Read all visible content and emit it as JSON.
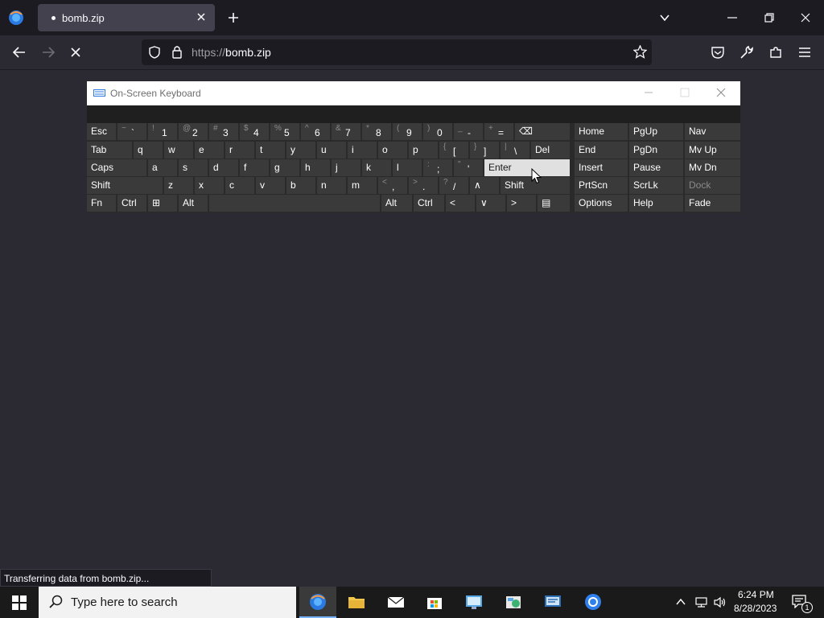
{
  "browser": {
    "tab_title": "bomb.zip",
    "url_scheme": "https://",
    "url_host": "bomb.zip",
    "status_text": "Transferring data from bomb.zip..."
  },
  "osk": {
    "title": "On-Screen Keyboard",
    "rows": [
      [
        {
          "main": "Esc"
        },
        {
          "main": "`",
          "shift": "~"
        },
        {
          "main": "1",
          "shift": "!"
        },
        {
          "main": "2",
          "shift": "@"
        },
        {
          "main": "3",
          "shift": "#"
        },
        {
          "main": "4",
          "shift": "$"
        },
        {
          "main": "5",
          "shift": "%"
        },
        {
          "main": "6",
          "shift": "^"
        },
        {
          "main": "7",
          "shift": "&"
        },
        {
          "main": "8",
          "shift": "*"
        },
        {
          "main": "9",
          "shift": "("
        },
        {
          "main": "0",
          "shift": ")"
        },
        {
          "main": "-",
          "shift": "_"
        },
        {
          "main": "=",
          "shift": "+"
        },
        {
          "main": "⌫"
        }
      ],
      [
        {
          "main": "Tab"
        },
        {
          "main": "q"
        },
        {
          "main": "w"
        },
        {
          "main": "e"
        },
        {
          "main": "r"
        },
        {
          "main": "t"
        },
        {
          "main": "y"
        },
        {
          "main": "u"
        },
        {
          "main": "i"
        },
        {
          "main": "o"
        },
        {
          "main": "p"
        },
        {
          "main": "[",
          "shift": "{"
        },
        {
          "main": "]",
          "shift": "}"
        },
        {
          "main": "\\",
          "shift": "|"
        },
        {
          "main": "Del"
        }
      ],
      [
        {
          "main": "Caps"
        },
        {
          "main": "a"
        },
        {
          "main": "s"
        },
        {
          "main": "d"
        },
        {
          "main": "f"
        },
        {
          "main": "g"
        },
        {
          "main": "h"
        },
        {
          "main": "j"
        },
        {
          "main": "k"
        },
        {
          "main": "l"
        },
        {
          "main": ";",
          "shift": ":"
        },
        {
          "main": "'",
          "shift": "\""
        },
        {
          "main": "Enter"
        }
      ],
      [
        {
          "main": "Shift"
        },
        {
          "main": "z"
        },
        {
          "main": "x"
        },
        {
          "main": "c"
        },
        {
          "main": "v"
        },
        {
          "main": "b"
        },
        {
          "main": "n"
        },
        {
          "main": "m"
        },
        {
          "main": ",",
          "shift": "<"
        },
        {
          "main": ".",
          "shift": ">"
        },
        {
          "main": "/",
          "shift": "?"
        },
        {
          "main": "∧"
        },
        {
          "main": "Shift"
        }
      ],
      [
        {
          "main": "Fn"
        },
        {
          "main": "Ctrl"
        },
        {
          "main": "⊞"
        },
        {
          "main": "Alt"
        },
        {
          "main": ""
        },
        {
          "main": "Alt"
        },
        {
          "main": "Ctrl"
        },
        {
          "main": "<"
        },
        {
          "main": "∨"
        },
        {
          "main": ">"
        },
        {
          "main": "▤"
        }
      ]
    ],
    "nav": [
      [
        "Home",
        "PgUp",
        "Nav"
      ],
      [
        "End",
        "PgDn",
        "Mv Up"
      ],
      [
        "Insert",
        "Pause",
        "Mv Dn"
      ],
      [
        "PrtScn",
        "ScrLk",
        "Dock"
      ],
      [
        "Options",
        "Help",
        "Fade"
      ]
    ]
  },
  "taskbar": {
    "search_placeholder": "Type here to search",
    "time": "6:24 PM",
    "date": "8/28/2023",
    "notification_count": "1"
  }
}
